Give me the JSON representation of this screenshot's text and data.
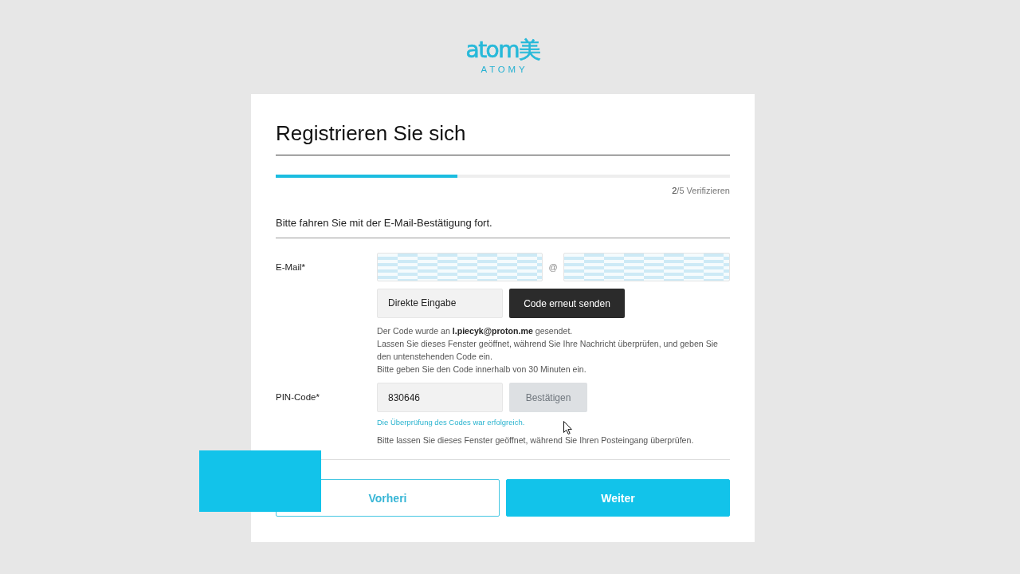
{
  "logo": {
    "wordmark": "atom美",
    "subtitle": "ATOMY"
  },
  "page": {
    "title": "Registrieren Sie sich"
  },
  "progress": {
    "level": 0.4,
    "label": "**2**/5 Verifizieren"
  },
  "instruction": "Bitte fahren Sie mit der E-Mail-Bestätigung fort.",
  "email": {
    "label": "E-Mail*",
    "local_part": {
      "redacted": true
    },
    "separator": "@",
    "domain": {
      "redacted": true
    },
    "domain_select": {
      "value": "Direkte Eingabe"
    },
    "resend_button": "Code erneut senden"
  },
  "notice": [
    "Der Code wurde an **l.piecyk@proton.me** gesendet.",
    "Lassen Sie dieses Fenster geöffnet, während Sie Ihre Nachricht überprüfen, und geben Sie den untenstehenden Code ein.",
    "Bitte geben Sie den Code innerhalb von 30 Minuten ein."
  ],
  "pin": {
    "label": "PIN-Code*",
    "value": "830646",
    "confirm_button": {
      "label": "Bestätigen",
      "disabled": true
    },
    "success": "Die Überprüfung des Codes war erfolgreich.",
    "hint": "Bitte lassen Sie dieses Fenster geöffnet, während Sie Ihren Posteingang überprüfen."
  },
  "buttons": [
    {
      "label": "Vorheri",
      "kind": "secondary"
    },
    {
      "label": "Weiter",
      "kind": "primary"
    }
  ]
}
